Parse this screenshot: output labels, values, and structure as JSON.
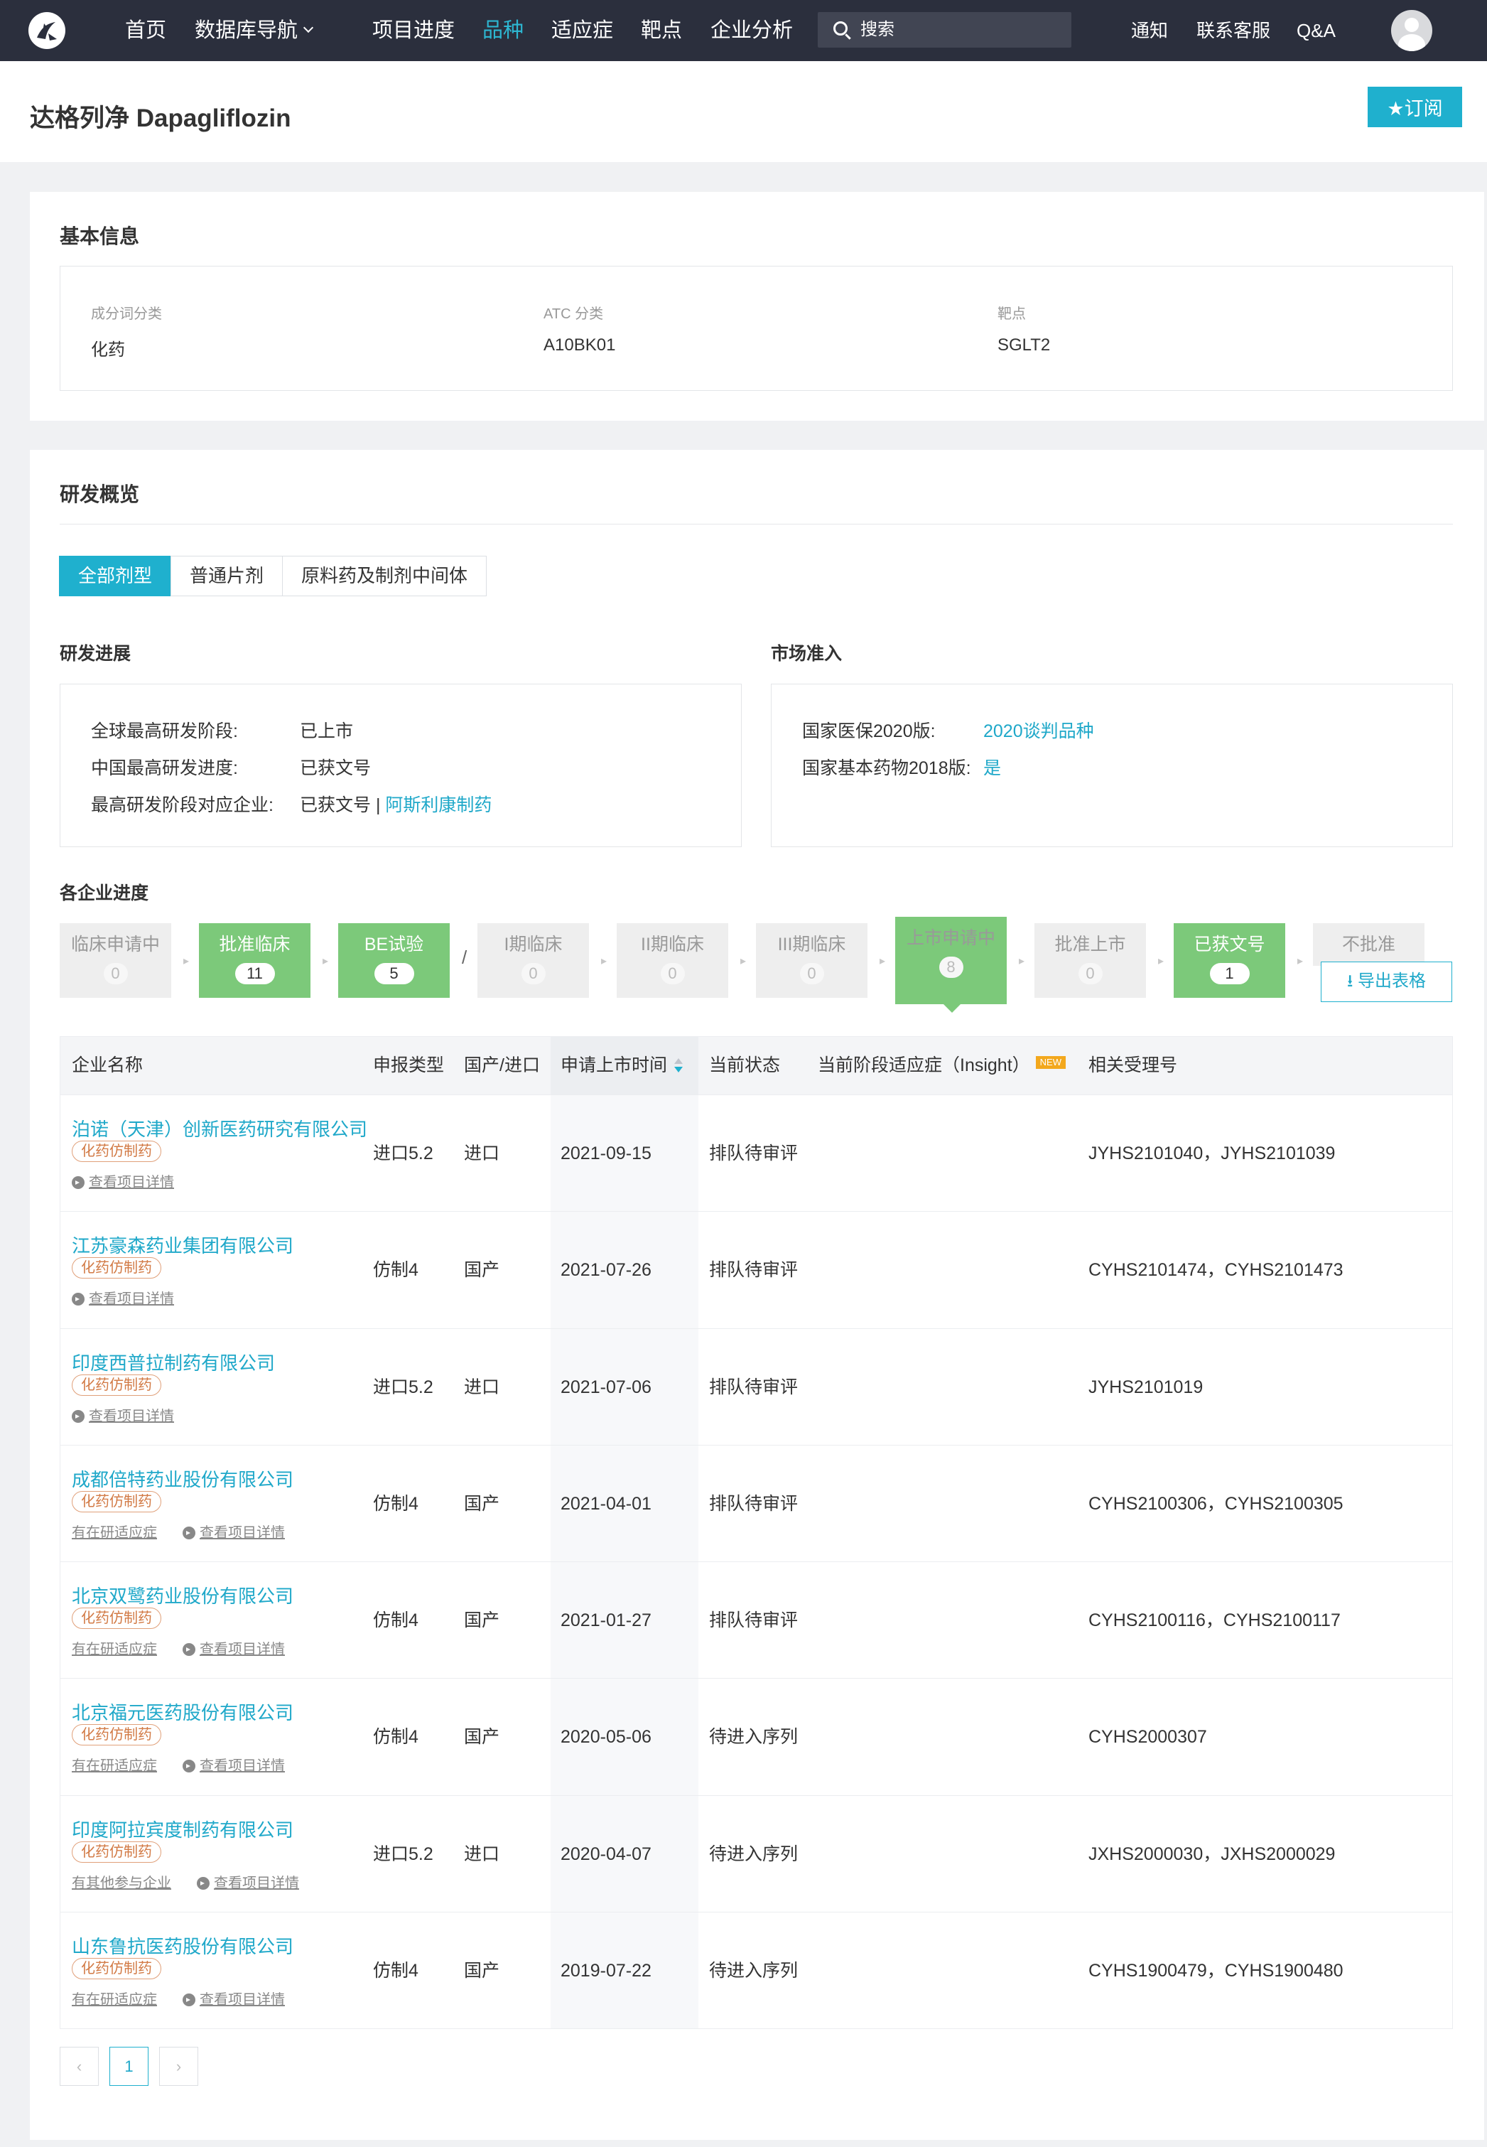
{
  "nav": {
    "items": [
      {
        "label": "首页"
      },
      {
        "label": "数据库导航",
        "has_dropdown": true
      },
      {
        "label": "项目进度"
      },
      {
        "label": "品种",
        "active": true
      },
      {
        "label": "适应症"
      },
      {
        "label": "靶点"
      },
      {
        "label": "企业分析"
      }
    ],
    "search_placeholder": "搜索",
    "right_links": [
      "通知",
      "联系客服",
      "Q&A"
    ]
  },
  "page": {
    "title": "达格列净 Dapagliflozin",
    "subscribe_label": "★订阅"
  },
  "basic_info": {
    "title": "基本信息",
    "fields": [
      {
        "label": "成分词分类",
        "value": "化药"
      },
      {
        "label": "ATC 分类",
        "value": "A10BK01"
      },
      {
        "label": "靶点",
        "value": "SGLT2"
      }
    ]
  },
  "rd_overview": {
    "title": "研发概览",
    "tabs": [
      {
        "label": "全部剂型",
        "active": true
      },
      {
        "label": "普通片剂"
      },
      {
        "label": "原料药及制剂中间体"
      }
    ],
    "progress": {
      "title": "研发进展",
      "global_label": "全球最高研发阶段:",
      "global_value": "已上市",
      "china_label": "中国最高研发进度:",
      "china_value": "已获文号",
      "company_label": "最高研发阶段对应企业:",
      "company_status": "已获文号 |",
      "company_name": "阿斯利康制药"
    },
    "market": {
      "title": "市场准入",
      "insurance_label": "国家医保2020版:",
      "insurance_value": "2020谈判品种",
      "essential_label": "国家基本药物2018版:",
      "essential_value": "是"
    }
  },
  "company_progress": {
    "title": "各企业进度",
    "stages": [
      {
        "name": "临床申请中",
        "count": "0",
        "state": "off"
      },
      {
        "name": "批准临床",
        "count": "11",
        "state": "on"
      },
      {
        "name": "BE试验",
        "count": "5",
        "state": "on"
      },
      {
        "name": "I期临床",
        "count": "0",
        "state": "off"
      },
      {
        "name": "II期临床",
        "count": "0",
        "state": "off"
      },
      {
        "name": "III期临床",
        "count": "0",
        "state": "off"
      },
      {
        "name": "上市申请中",
        "count": "8",
        "state": "active"
      },
      {
        "name": "批准上市",
        "count": "0",
        "state": "off"
      },
      {
        "name": "已获文号",
        "count": "1",
        "state": "on"
      },
      {
        "name": "不批准",
        "count": "",
        "state": "off"
      }
    ],
    "slash": "/",
    "export_label": "导出表格"
  },
  "table": {
    "headers": {
      "company": "企业名称",
      "type": "申报类型",
      "origin": "国产/进口",
      "date": "申请上市时间",
      "status": "当前状态",
      "indication": "当前阶段适应症（Insight）",
      "new_badge": "NEW",
      "acceptance": "相关受理号"
    },
    "tag_label": "化药仿制药",
    "detail_link": "查看项目详情",
    "rows": [
      {
        "company": "泊诺（天津）创新医药研究有限公司",
        "type": "进口5.2",
        "origin": "进口",
        "date": "2021-09-15",
        "status": "排队待审评",
        "acceptance": "JYHS2101040，JYHS2101039",
        "extra": ""
      },
      {
        "company": "江苏豪森药业集团有限公司",
        "type": "仿制4",
        "origin": "国产",
        "date": "2021-07-26",
        "status": "排队待审评",
        "acceptance": "CYHS2101474，CYHS2101473",
        "extra": ""
      },
      {
        "company": "印度西普拉制药有限公司",
        "type": "进口5.2",
        "origin": "进口",
        "date": "2021-07-06",
        "status": "排队待审评",
        "acceptance": "JYHS2101019",
        "extra": ""
      },
      {
        "company": "成都倍特药业股份有限公司",
        "type": "仿制4",
        "origin": "国产",
        "date": "2021-04-01",
        "status": "排队待审评",
        "acceptance": "CYHS2100306，CYHS2100305",
        "extra": "有在研适应症"
      },
      {
        "company": "北京双鹭药业股份有限公司",
        "type": "仿制4",
        "origin": "国产",
        "date": "2021-01-27",
        "status": "排队待审评",
        "acceptance": "CYHS2100116，CYHS2100117",
        "extra": "有在研适应症"
      },
      {
        "company": "北京福元医药股份有限公司",
        "type": "仿制4",
        "origin": "国产",
        "date": "2020-05-06",
        "status": "待进入序列",
        "acceptance": "CYHS2000307",
        "extra": "有在研适应症"
      },
      {
        "company": "印度阿拉宾度制药有限公司",
        "type": "进口5.2",
        "origin": "进口",
        "date": "2020-04-07",
        "status": "待进入序列",
        "acceptance": "JXHS2000030，JXHS2000029",
        "extra": "有其他参与企业"
      },
      {
        "company": "山东鲁抗医药股份有限公司",
        "type": "仿制4",
        "origin": "国产",
        "date": "2019-07-22",
        "status": "待进入序列",
        "acceptance": "CYHS1900479，CYHS1900480",
        "extra": "有在研适应症"
      }
    ]
  },
  "pagination": {
    "prev": "‹",
    "current": "1",
    "next": "›"
  },
  "colors": {
    "nav_bg": "#2b2f3d",
    "accent": "#1fb0ce",
    "stage_green": "#7cc97a",
    "tag_orange": "#d27a45"
  }
}
